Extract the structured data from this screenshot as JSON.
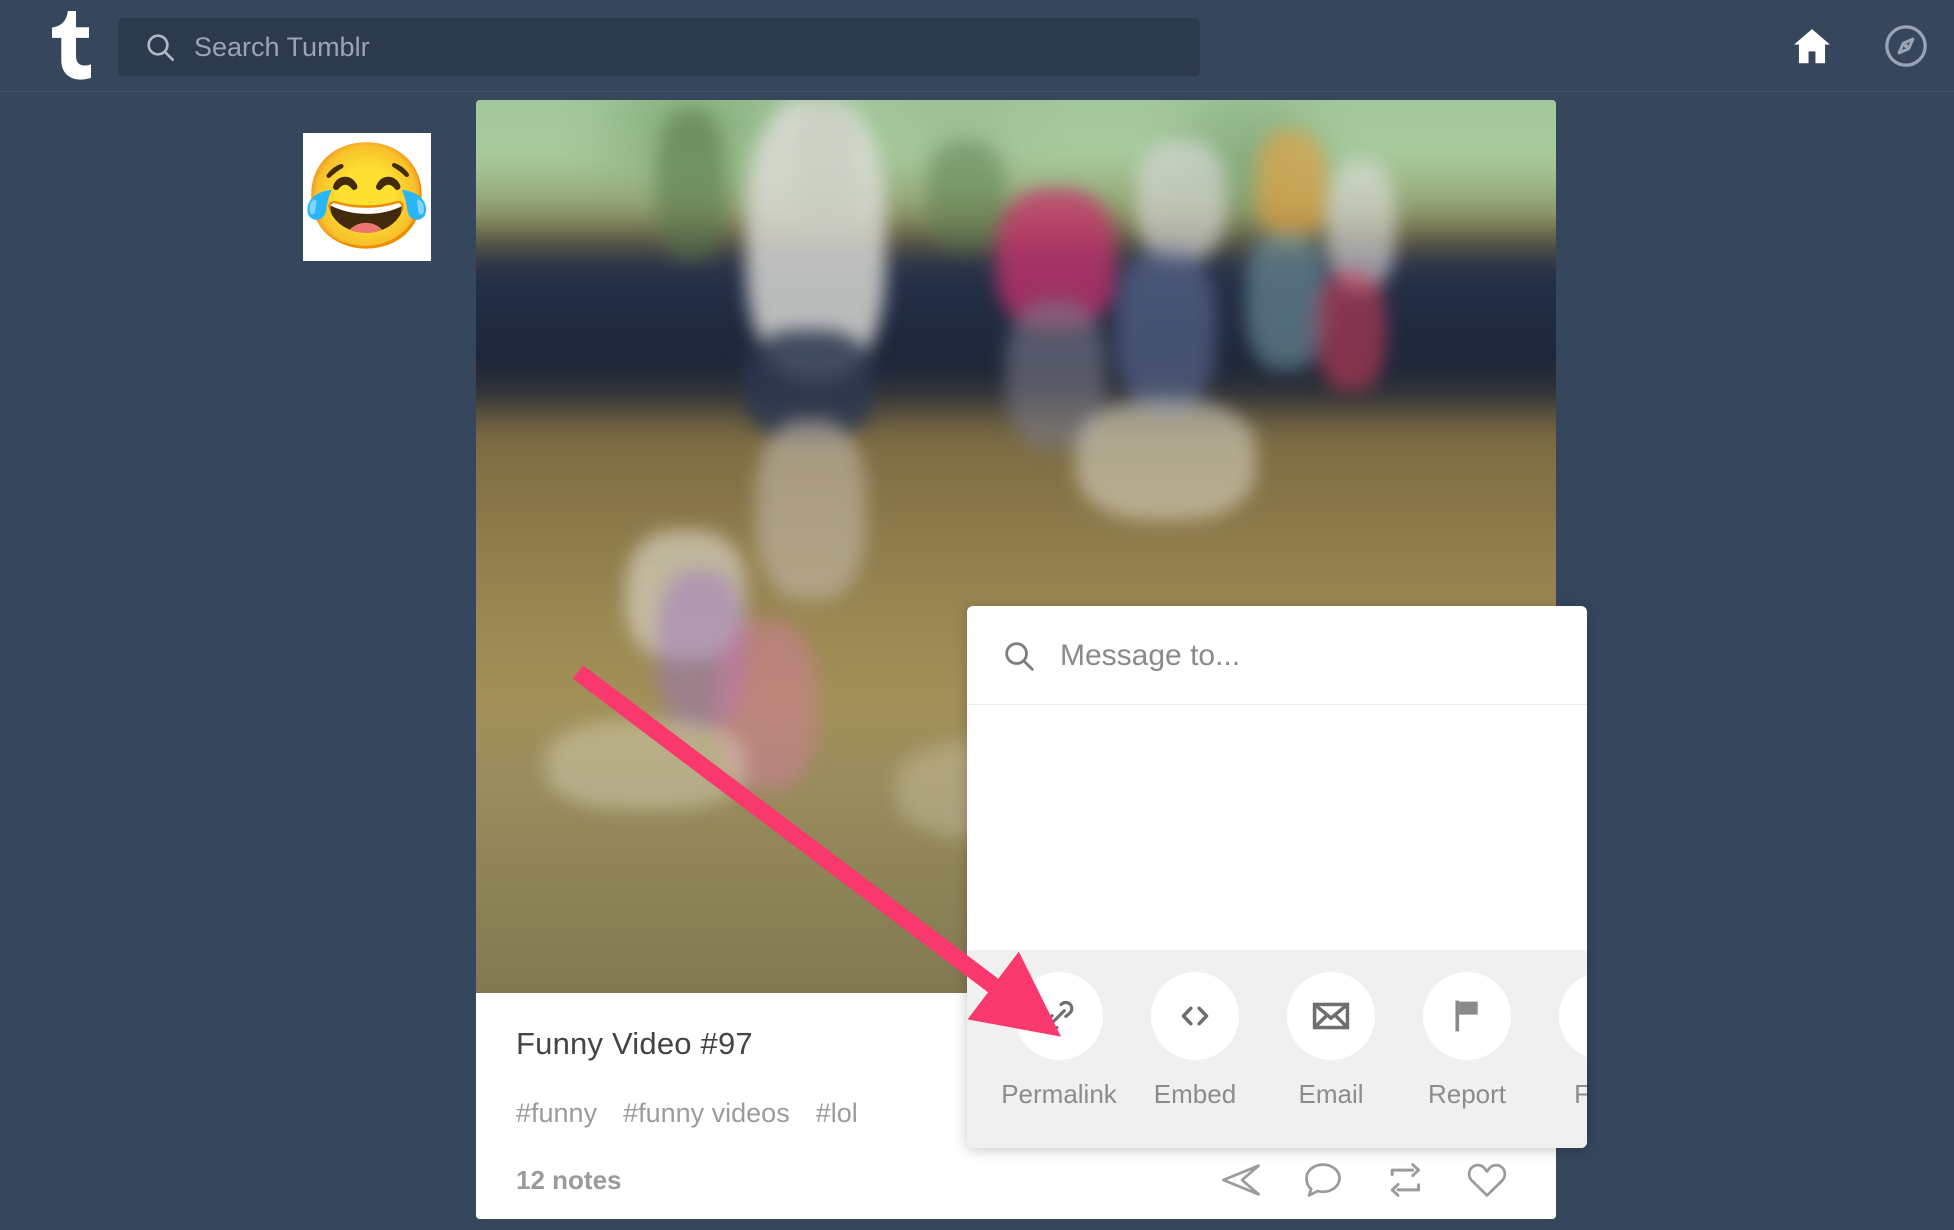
{
  "header": {
    "logo_icon": "tumblr-t-logo",
    "search": {
      "icon": "search-icon",
      "value": "",
      "placeholder": "Search Tumblr"
    },
    "icons": [
      {
        "name": "home-icon",
        "label": "Home"
      },
      {
        "name": "explore-compass-icon",
        "label": "Explore"
      }
    ],
    "background_color": "#36465d"
  },
  "avatar": {
    "name": "blog-avatar",
    "emoji": "😂",
    "emoji_name": "face-with-tears-of-joy"
  },
  "post": {
    "media_type": "video",
    "title": "Funny Video #97",
    "tags": [
      "#funny",
      "#funny videos",
      "#lol"
    ],
    "notes": "12 notes",
    "actions": [
      {
        "name": "share-icon",
        "label": "Share"
      },
      {
        "name": "reply-bubble-icon",
        "label": "Reply"
      },
      {
        "name": "reblog-icon",
        "label": "Reblog"
      },
      {
        "name": "like-heart-icon",
        "label": "Like"
      }
    ]
  },
  "share_popup": {
    "message_search": {
      "icon": "search-icon",
      "value": "",
      "placeholder": "Message to..."
    },
    "items": [
      {
        "label": "Permalink",
        "icon": "chain-link-icon",
        "color": "#6e6e6e"
      },
      {
        "label": "Embed",
        "icon": "code-brackets-icon",
        "color": "#6e6e6e"
      },
      {
        "label": "Email",
        "icon": "envelope-icon",
        "color": "#6e6e6e"
      },
      {
        "label": "Report",
        "icon": "flag-icon",
        "color": "#8a8a8a"
      },
      {
        "label": "Face",
        "icon": "facebook-icon",
        "color": "#3b5998"
      }
    ],
    "footer_background": "#f0f0f0"
  },
  "annotation": {
    "arrow_color": "#f9386e",
    "points_to": "Permalink"
  }
}
